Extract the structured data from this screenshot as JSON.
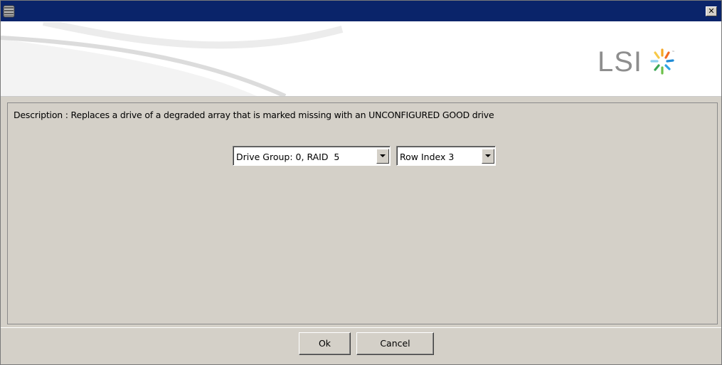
{
  "titlebar": {
    "app_icon": "database-icon",
    "close_label": "✕"
  },
  "banner": {
    "logo_text": "LSI",
    "logo_icon": "lsi-starburst-logo"
  },
  "description": {
    "text": "Description : Replaces a drive of a degraded array that is marked missing with an UNCONFIGURED GOOD drive"
  },
  "selectors": {
    "drive_group": {
      "value": "Drive Group: 0, RAID  5"
    },
    "row_index": {
      "value": "Row Index 3"
    }
  },
  "buttons": {
    "ok": "Ok",
    "cancel": "Cancel"
  },
  "colors": {
    "titlebar": "#0a246a",
    "dialog_bg": "#d4d0c8",
    "logo_gray": "#8e8e8e"
  }
}
